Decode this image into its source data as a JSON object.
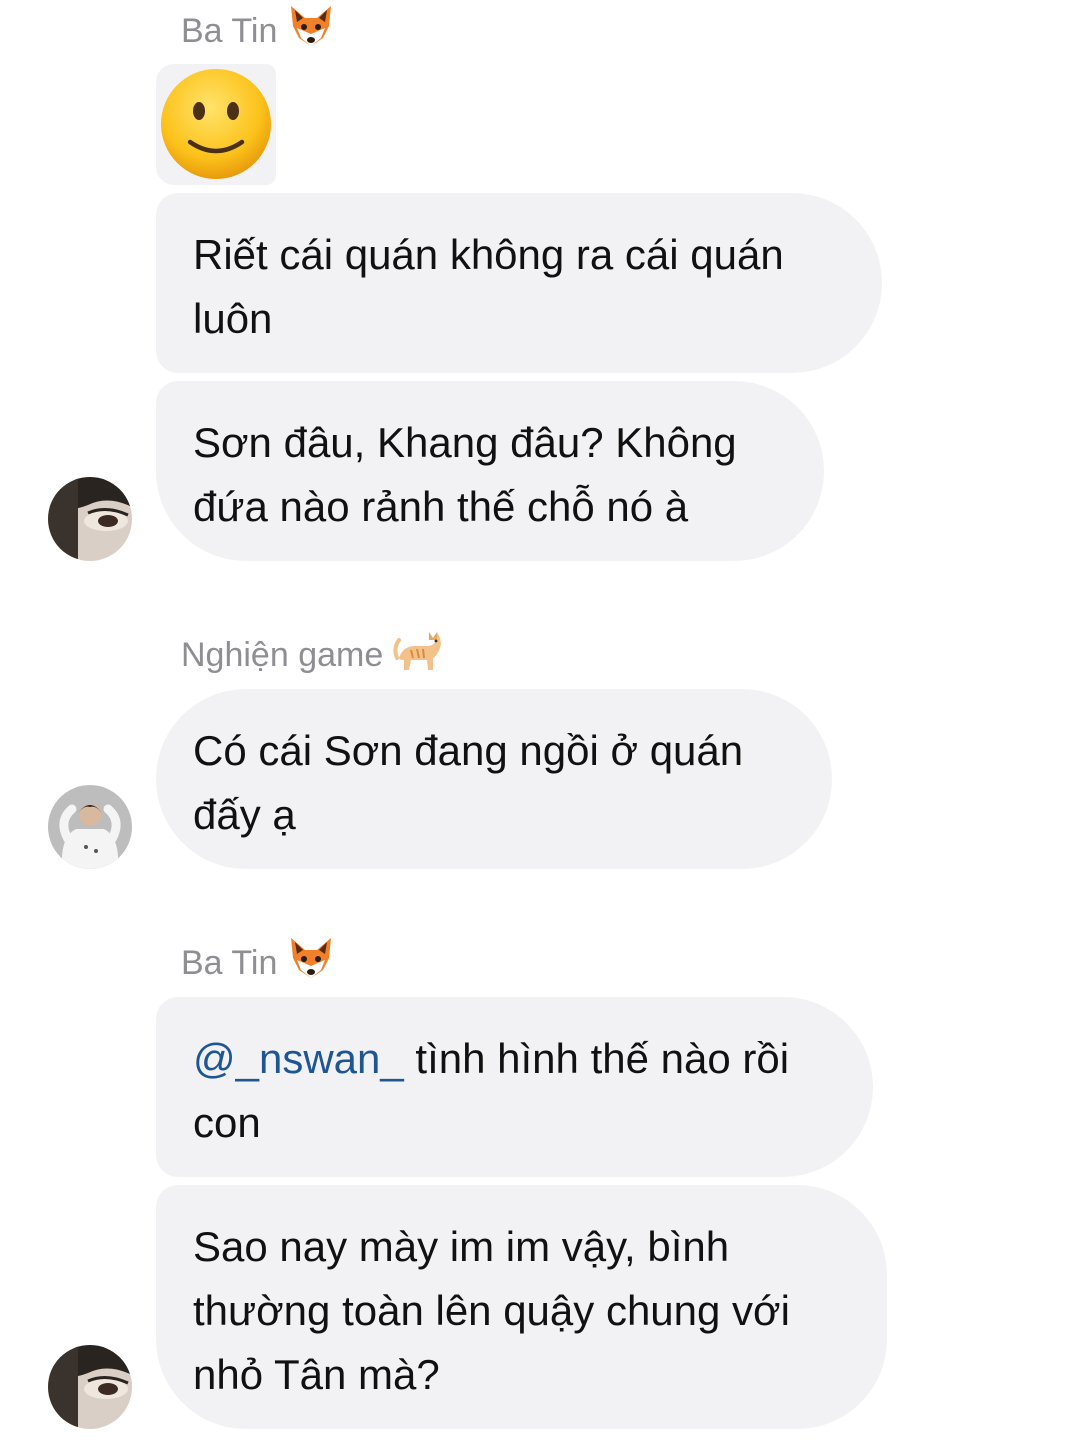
{
  "messages": [
    {
      "sender": "Ba Tin",
      "sender_emoji": "fox-face-icon",
      "big_emoji": "slightly-smiling-face-icon",
      "bubbles": [
        {
          "lines": [
            "Riết cái quán không ra cái quán",
            "luôn"
          ]
        },
        {
          "lines": [
            "Sơn đâu, Khang đâu? Không",
            "đứa nào rảnh thế chỗ nó à"
          ]
        }
      ]
    },
    {
      "sender": "Nghiện game",
      "sender_emoji": "cat-icon",
      "bubbles": [
        {
          "lines": [
            "Có cái Sơn đang ngồi ở quán",
            "đấy ạ"
          ]
        }
      ]
    },
    {
      "sender": "Ba Tin",
      "sender_emoji": "fox-face-icon",
      "bubbles": [
        {
          "mention": "@_nswan_",
          "first_line_rest": " tình hình thế nào rồi",
          "lines": [
            "con"
          ]
        },
        {
          "lines": [
            "Sao nay mày im im vậy, bình",
            "thường toàn lên quậy chung với",
            "nhỏ Tân mà?"
          ]
        }
      ]
    }
  ],
  "colors": {
    "bubble_bg": "#f2f2f4",
    "sender_name": "#8e8e93",
    "mention": "#1e5694",
    "text": "#111111"
  }
}
